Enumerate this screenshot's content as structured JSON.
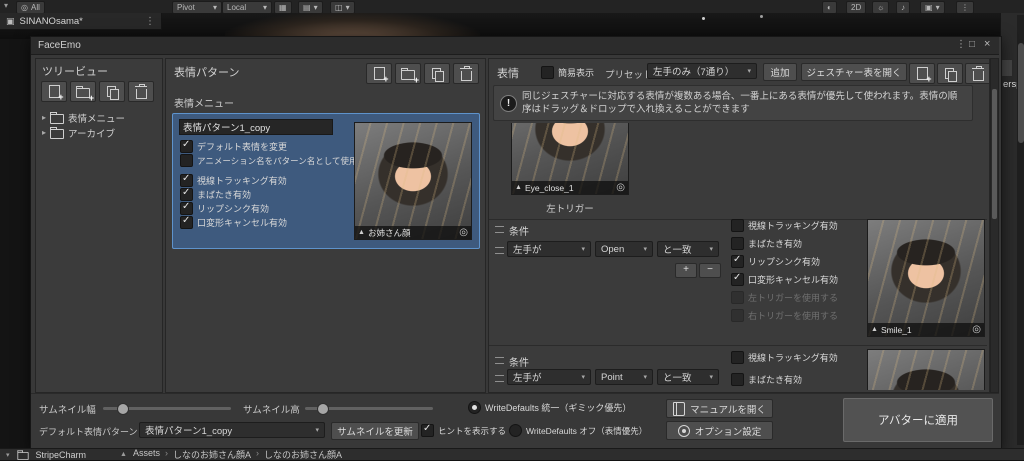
{
  "icons": {
    "window_menu": "⋮",
    "window_max": "□",
    "window_close": "×",
    "caret_down": "▾",
    "caret_right": "▸",
    "breadcrumb_sep": "›",
    "thumb_marker": "▲",
    "target": "◎",
    "info_mark": "!",
    "plus": "+",
    "minus": "−",
    "asset_up": "▲",
    "half_circle": "◐",
    "grid": "▦",
    "snap": "▤",
    "move_tool": "◫",
    "cube": "▣",
    "sun": "☼",
    "note": "♪",
    "dots": "⋮",
    "layers_dot": "◎"
  },
  "unity": {
    "toolbar": {
      "layers": "All",
      "pivot": "Pivot",
      "local": "Local",
      "mode_2d": "2D"
    },
    "hierarchy_tab": "SINANOsama*",
    "inspector_fragment": "ersp",
    "status": {
      "left_item": "StripeCharm",
      "breadcrumb": [
        "Assets",
        "しなのお姉さん顔A",
        "しなのお姉さん顔A"
      ]
    }
  },
  "window": {
    "title": "FaceEmo",
    "tree": {
      "title": "ツリービュー",
      "items": [
        {
          "label": "表情メニュー"
        },
        {
          "label": "アーカイブ"
        }
      ]
    },
    "pattern": {
      "title": "表情パターン",
      "menu_label": "表情メニュー",
      "card": {
        "name": "表情パターン1_copy",
        "options": [
          {
            "label": "デフォルト表情を変更",
            "checked": true
          },
          {
            "label": "アニメーション名をパターン名として使用",
            "checked": false
          },
          {
            "label": "視線トラッキング有効",
            "checked": true
          },
          {
            "label": "まばたき有効",
            "checked": true
          },
          {
            "label": "リップシンク有効",
            "checked": true
          },
          {
            "label": "口変形キャンセル有効",
            "checked": true
          }
        ],
        "thumb_label": "お姉さん顔"
      }
    },
    "expression": {
      "title": "表情",
      "simple_view": {
        "label": "簡易表示",
        "checked": false
      },
      "preset_label": "プリセット",
      "preset_value": "左手のみ（7通り）",
      "add_button": "追加",
      "gesture_table_button": "ジェスチャー表を開く",
      "info": "同じジェスチャーに対応する表情が複数ある場合、一番上にある表情が優先して使われます。表情の順序はドラッグ＆ドロップで入れ換えることができます",
      "top_item": {
        "thumb_label": "Eye_close_1",
        "caption": "左トリガー"
      },
      "blocks": [
        {
          "condition_label": "条件",
          "hand": "左手が",
          "gesture": "Open",
          "match": "と一致",
          "options": [
            {
              "label": "視線トラッキング有効",
              "checked": false
            },
            {
              "label": "まばたき有効",
              "checked": false
            },
            {
              "label": "リップシンク有効",
              "checked": true
            },
            {
              "label": "口変形キャンセル有効",
              "checked": true
            },
            {
              "label": "左トリガーを使用する",
              "checked": false
            },
            {
              "label": "右トリガーを使用する",
              "checked": false
            }
          ],
          "thumb_label": "Smile_1"
        },
        {
          "condition_label": "条件",
          "hand": "左手が",
          "gesture": "Point",
          "match": "と一致",
          "options": [
            {
              "label": "視線トラッキング有効",
              "checked": false
            },
            {
              "label": "まばたき有効",
              "checked": false
            }
          ]
        }
      ]
    },
    "footer": {
      "thumb_width_label": "サムネイル幅",
      "thumb_height_label": "サムネイル高",
      "wd_unify": {
        "label": "WriteDefaults 統一（ギミック優先）",
        "selected": true
      },
      "wd_off": {
        "label": "WriteDefaults オフ（表情優先）",
        "selected": false
      },
      "manual_button": "マニュアルを開く",
      "default_pattern_label": "デフォルト表情パターン",
      "default_pattern_value": "表情パターン1_copy",
      "update_thumbs_button": "サムネイルを更新",
      "show_hints": {
        "label": "ヒントを表示する",
        "checked": true
      },
      "options_button": "オプション設定",
      "apply_button": "アバターに適用"
    }
  }
}
